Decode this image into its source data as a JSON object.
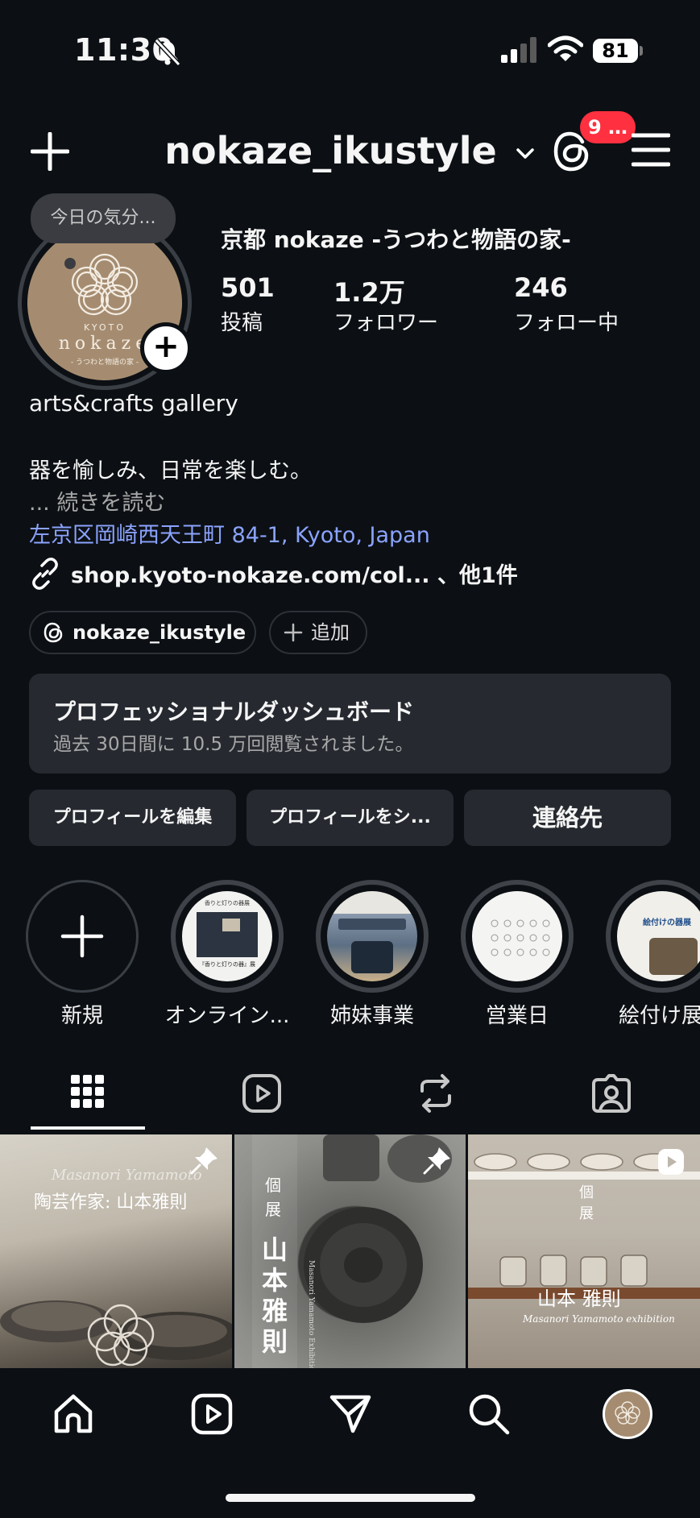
{
  "status_bar": {
    "time": "11:30",
    "battery": "81"
  },
  "header": {
    "username": "nokaze_ikustyle",
    "threads_badge": "9 …"
  },
  "profile": {
    "note": "今日の気分...",
    "avatar_text_top": "KYOTO",
    "avatar_text_brand": "nokaze",
    "avatar_text_sub": "- うつわと物語の家 -",
    "display_name": "京都 nokaze -うつわと物語の家-",
    "stats": [
      {
        "value": "501",
        "label": "投稿"
      },
      {
        "value": "1.2万",
        "label": "フォロワー"
      },
      {
        "value": "246",
        "label": "フォロー中"
      }
    ],
    "category": "arts&crafts gallery",
    "bio": "器を愉しみ、日常を楽しむ。",
    "more": "... 続きを読む",
    "address": "左京区岡崎西天王町 84-1, Kyoto, Japan",
    "link": "shop.kyoto-nokaze.com/col... 、他1件"
  },
  "chips": {
    "threads": "nokaze_ikustyle",
    "add": "追加"
  },
  "dashboard": {
    "title": "プロフェッショナルダッシュボード",
    "subtitle": "過去 30日間に 10.5 万回閲覧されました。"
  },
  "buttons": {
    "edit": "プロフィールを編集",
    "share": "プロフィールをシ...",
    "contact": "連絡先"
  },
  "highlights": [
    {
      "label": "新規"
    },
    {
      "label": "オンライン...",
      "inner_top": "香りと灯りの器展",
      "inner_bottom": "『香りと灯りの器』展"
    },
    {
      "label": "姉妹事業",
      "inner_top": ""
    },
    {
      "label": "営業日",
      "inner_top": ""
    },
    {
      "label": "絵付け展",
      "inner_top": "絵付けの器展"
    }
  ],
  "grid": [
    {
      "title": "陶芸作家: 山本雅則",
      "script": "Masanori Yamamoto",
      "icon": "pin-icon"
    },
    {
      "vertical_small": "個展",
      "vertical_big": "山本 雅則",
      "side": "Masanori Yamamoto  Exhibition",
      "icon": "pin-icon"
    },
    {
      "vertical_small": "個展",
      "name": "山本 雅則",
      "script": "Masanori Yamamoto exhibition",
      "icon": "reel-icon"
    }
  ],
  "colors": {
    "background": "#0c1014",
    "link": "#8ba3ff",
    "badge": "#ff3040",
    "surface": "#262a30"
  }
}
